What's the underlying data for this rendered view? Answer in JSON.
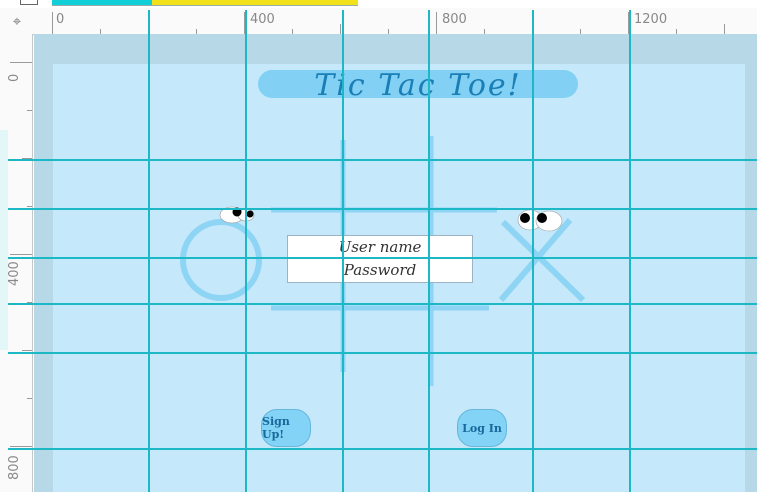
{
  "ruler": {
    "h_labels": [
      "0",
      "400",
      "800",
      "1200"
    ],
    "v_labels": [
      "0",
      "400",
      "800"
    ]
  },
  "app": {
    "title": "Tic Tac Toe!"
  },
  "login": {
    "username_placeholder": "User name",
    "password_placeholder": "Password"
  },
  "buttons": {
    "signup_label": "Sign Up!",
    "login_label": "Log In"
  },
  "colors": {
    "guide": "#1cb8c6",
    "artboard": "#c5e9fa",
    "canvas": "#b7d8e6",
    "pill": "#82d0f3",
    "title_text": "#1b7fb7",
    "board_lines": "#8ed4f5"
  }
}
